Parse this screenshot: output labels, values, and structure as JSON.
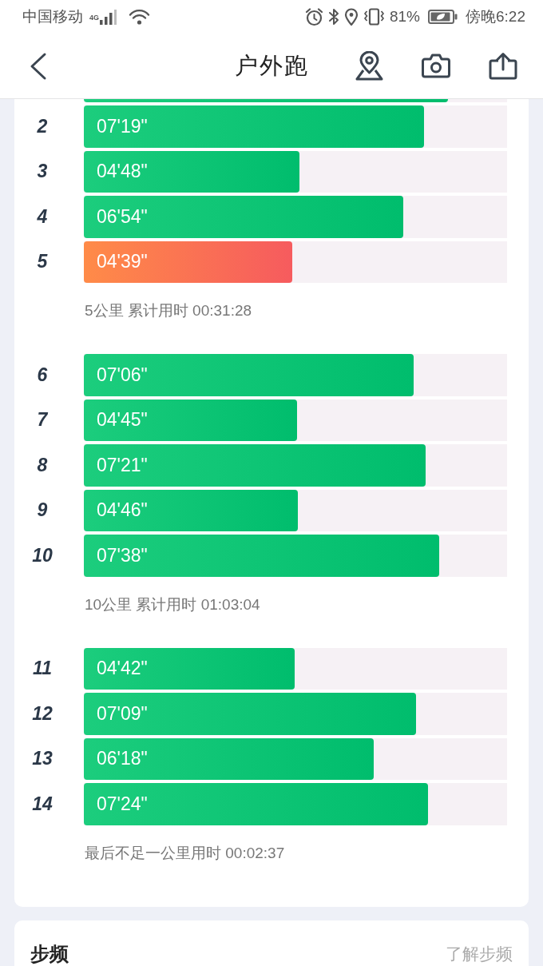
{
  "status_bar": {
    "carrier": "中国移动",
    "network": "4G",
    "battery": "81%",
    "time": "傍晚6:22"
  },
  "header": {
    "title": "户外跑"
  },
  "splits": {
    "cut_row": {
      "level": 0.86
    },
    "groups": [
      {
        "rows": [
          {
            "km": "2",
            "pace": "07'19\"",
            "level": 0.804,
            "fastest": false
          },
          {
            "km": "3",
            "pace": "04'48\"",
            "level": 0.509,
            "fastest": false
          },
          {
            "km": "4",
            "pace": "06'54\"",
            "level": 0.755,
            "fastest": false
          },
          {
            "km": "5",
            "pace": "04'39\"",
            "level": 0.492,
            "fastest": true
          }
        ],
        "summary": "5公里 累计用时 00:31:28"
      },
      {
        "rows": [
          {
            "km": "6",
            "pace": "07'06\"",
            "level": 0.779,
            "fastest": false
          },
          {
            "km": "7",
            "pace": "04'45\"",
            "level": 0.504,
            "fastest": false
          },
          {
            "km": "8",
            "pace": "07'21\"",
            "level": 0.808,
            "fastest": false
          },
          {
            "km": "9",
            "pace": "04'46\"",
            "level": 0.506,
            "fastest": false
          },
          {
            "km": "10",
            "pace": "07'38\"",
            "level": 0.84,
            "fastest": false
          }
        ],
        "summary": "10公里 累计用时 01:03:04"
      },
      {
        "rows": [
          {
            "km": "11",
            "pace": "04'42\"",
            "level": 0.498,
            "fastest": false
          },
          {
            "km": "12",
            "pace": "07'09\"",
            "level": 0.785,
            "fastest": false
          },
          {
            "km": "13",
            "pace": "06'18\"",
            "level": 0.685,
            "fastest": false
          },
          {
            "km": "14",
            "pace": "07'24\"",
            "level": 0.813,
            "fastest": false
          }
        ],
        "summary": "最后不足一公里用时 00:02:37"
      }
    ]
  },
  "cadence_card": {
    "title": "步频",
    "link": "了解步频"
  }
}
